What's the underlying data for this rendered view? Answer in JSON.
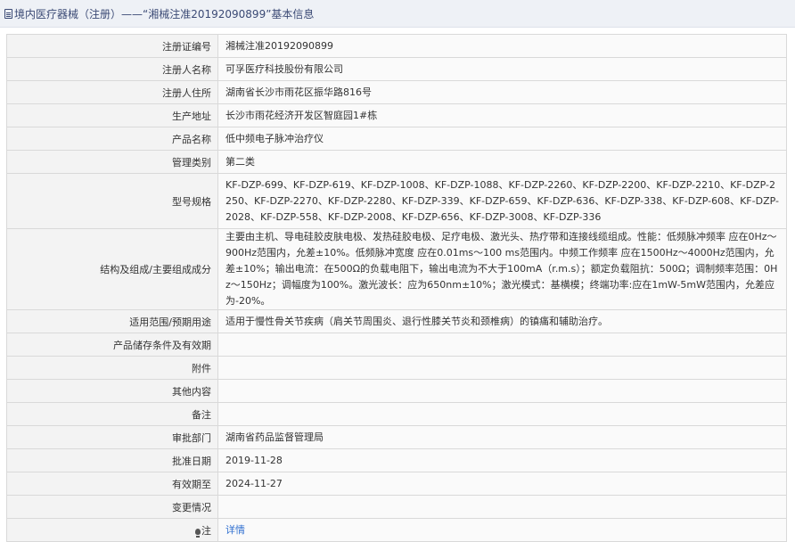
{
  "header": {
    "title": "境内医疗器械（注册）——“湘械注准20192090899”基本信息"
  },
  "rows": [
    {
      "label": "注册证编号",
      "value": "湘械注准20192090899"
    },
    {
      "label": "注册人名称",
      "value": "可孚医疗科技股份有限公司"
    },
    {
      "label": "注册人住所",
      "value": "湖南省长沙市雨花区振华路816号"
    },
    {
      "label": "生产地址",
      "value": "长沙市雨花经济开发区智庭园1#栋"
    },
    {
      "label": "产品名称",
      "value": "低中频电子脉冲治疗仪"
    },
    {
      "label": "管理类别",
      "value": "第二类"
    },
    {
      "label": "型号规格",
      "value": "KF-DZP-699、KF-DZP-619、KF-DZP-1008、KF-DZP-1088、KF-DZP-2260、KF-DZP-2200、KF-DZP-2210、KF-DZP-2250、KF-DZP-2270、KF-DZP-2280、KF-DZP-339、KF-DZP-659、KF-DZP-636、KF-DZP-338、KF-DZP-608、KF-DZP-2028、KF-DZP-558、KF-DZP-2008、KF-DZP-656、KF-DZP-3008、KF-DZP-336"
    },
    {
      "label": "结构及组成/主要组成成分",
      "value": "主要由主机、导电硅胶皮肤电极、发热硅胶电极、足疗电极、激光头、热疗带和连接线缆组成。性能：低频脉冲频率 应在0Hz～900Hz范围内，允差±10%。低频脉冲宽度 应在0.01ms～100 ms范围内。中频工作频率 应在1500Hz～4000Hz范围内，允差±10%；输出电流：在500Ω的负载电阻下，输出电流为不大于100mA（r.m.s）；额定负载阻抗：500Ω；调制频率范围：0Hz～150Hz；调幅度为100%。激光波长：应为650nm±10%；激光模式：基横模；终端功率:应在1mW-5mW范围内，允差应为-20%。"
    },
    {
      "label": "适用范围/预期用途",
      "value": "适用于慢性骨关节疾病（肩关节周围炎、退行性膝关节炎和颈椎病）的镇痛和辅助治疗。"
    },
    {
      "label": "产品储存条件及有效期",
      "value": ""
    },
    {
      "label": "附件",
      "value": ""
    },
    {
      "label": "其他内容",
      "value": ""
    },
    {
      "label": "备注",
      "value": ""
    },
    {
      "label": "审批部门",
      "value": "湖南省药品监督管理局"
    },
    {
      "label": "批准日期",
      "value": "2019-11-28"
    },
    {
      "label": "有效期至",
      "value": "2024-11-27"
    },
    {
      "label": "变更情况",
      "value": ""
    }
  ],
  "note": {
    "label": "注",
    "link": "详情",
    "icon": "lightbulb-icon"
  }
}
